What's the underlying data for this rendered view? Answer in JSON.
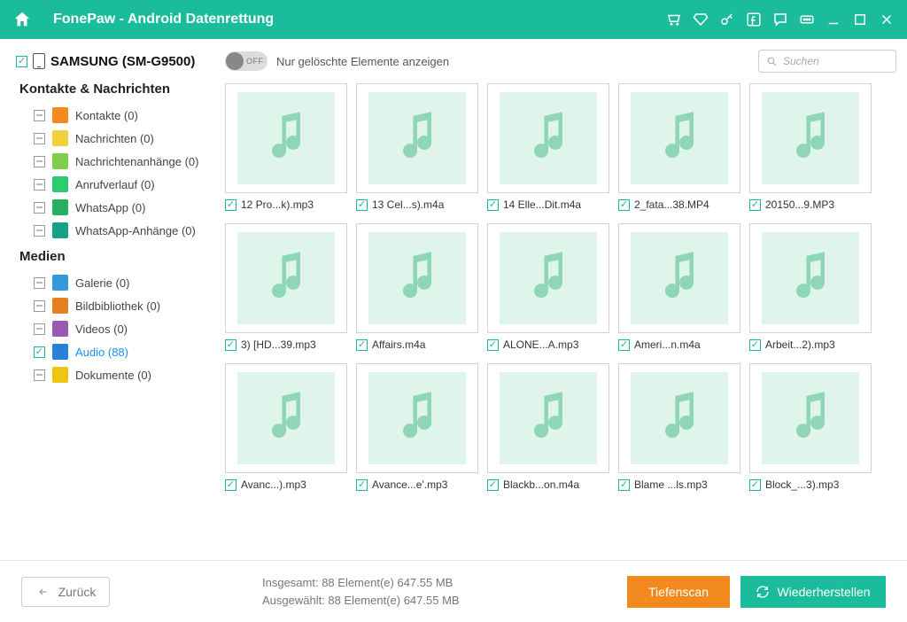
{
  "app_title": "FonePaw - Android Datenrettung",
  "device_name": "SAMSUNG (SM-G9500)",
  "toggle_off_text": "OFF",
  "toggle_label": "Nur gelöschte Elemente anzeigen",
  "search_placeholder": "Suchen",
  "section_contacts": "Kontakte & Nachrichten",
  "section_media": "Medien",
  "sidebar_contacts": [
    {
      "label": "Kontakte (0)",
      "color": "#f28a1f"
    },
    {
      "label": "Nachrichten (0)",
      "color": "#f4d03f"
    },
    {
      "label": "Nachrichtenanhänge (0)",
      "color": "#7fcf4a"
    },
    {
      "label": "Anrufverlauf (0)",
      "color": "#2ecc71"
    },
    {
      "label": "WhatsApp (0)",
      "color": "#27ae60"
    },
    {
      "label": "WhatsApp-Anhänge (0)",
      "color": "#16a085"
    }
  ],
  "sidebar_media": [
    {
      "label": "Galerie (0)",
      "color": "#3498db",
      "active": false,
      "checked": false
    },
    {
      "label": "Bildbibliothek (0)",
      "color": "#e67e22",
      "active": false,
      "checked": false
    },
    {
      "label": "Videos (0)",
      "color": "#9b59b6",
      "active": false,
      "checked": false
    },
    {
      "label": "Audio (88)",
      "color": "#2980d9",
      "active": true,
      "checked": true
    },
    {
      "label": "Dokumente (0)",
      "color": "#f1c40f",
      "active": false,
      "checked": false
    }
  ],
  "files": [
    "12 Pro...k).mp3",
    "13 Cel...s).m4a",
    "14 Elle...Dit.m4a",
    "2_fata...38.MP4",
    "20150...9.MP3",
    "3) [HD...39.mp3",
    "Affairs.m4a",
    "ALONE...A.mp3",
    "Ameri...n.m4a",
    "Arbeit...2).mp3",
    "Avanc...).mp3",
    "Avance...e'.mp3",
    "Blackb...on.m4a",
    "Blame ...ls.mp3",
    "Block_...3).mp3"
  ],
  "stats_total": "Insgesamt: 88 Element(e) 647.55 MB",
  "stats_selected": "Ausgewählt: 88 Element(e) 647.55 MB",
  "btn_back": "Zurück",
  "btn_deepscan": "Tiefenscan",
  "btn_recover": "Wiederherstellen"
}
